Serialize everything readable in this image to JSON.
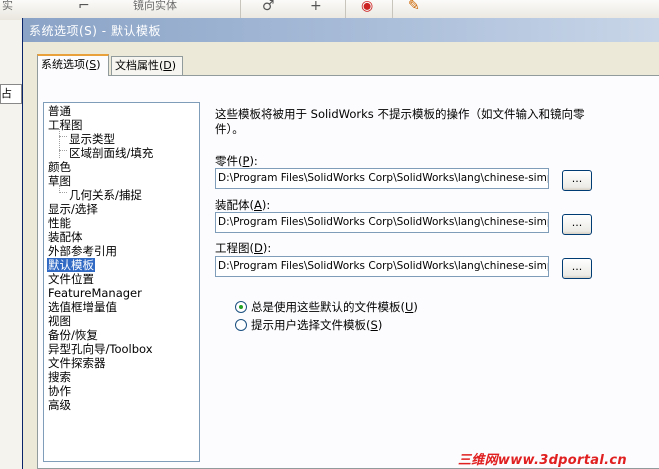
{
  "background_app": {
    "toolbar_label": "镜向实体",
    "left_strip_fragment_1": "实",
    "left_strip_fragment_2": "占",
    "icons": [
      "curve-icon",
      "plus-icon",
      "target-icon",
      "sketch-icon"
    ]
  },
  "dialog": {
    "title": "系统选项(S) - 默认模板",
    "tabs": [
      {
        "label": "系统选项",
        "mnemonic": "S",
        "active": true
      },
      {
        "label": "文档属性",
        "mnemonic": "D",
        "active": false
      }
    ],
    "tree": [
      {
        "label": "普通",
        "level": 0
      },
      {
        "label": "工程图",
        "level": 0
      },
      {
        "label": "显示类型",
        "level": 1
      },
      {
        "label": "区域剖面线/填充",
        "level": 1
      },
      {
        "label": "颜色",
        "level": 0
      },
      {
        "label": "草图",
        "level": 0
      },
      {
        "label": "几何关系/捕捉",
        "level": 1
      },
      {
        "label": "显示/选择",
        "level": 0
      },
      {
        "label": "性能",
        "level": 0
      },
      {
        "label": "装配体",
        "level": 0
      },
      {
        "label": "外部参考引用",
        "level": 0
      },
      {
        "label": "默认模板",
        "level": 0,
        "selected": true
      },
      {
        "label": "文件位置",
        "level": 0
      },
      {
        "label": "FeatureManager",
        "level": 0
      },
      {
        "label": "选值框增量值",
        "level": 0
      },
      {
        "label": "视图",
        "level": 0
      },
      {
        "label": "备份/恢复",
        "level": 0
      },
      {
        "label": "异型孔向导/Toolbox",
        "level": 0
      },
      {
        "label": "文件探索器",
        "level": 0
      },
      {
        "label": "搜索",
        "level": 0
      },
      {
        "label": "协作",
        "level": 0
      },
      {
        "label": "高级",
        "level": 0
      }
    ],
    "description": "这些模板将被用于 SolidWorks 不提示模板的操作（如文件输入和镜向零件）。",
    "fields": [
      {
        "label": "零件",
        "mnemonic": "P",
        "value": "D:\\Program Files\\SolidWorks Corp\\SolidWorks\\lang\\chinese-simplified\\Tutorial\\part.prtdot",
        "button": "..."
      },
      {
        "label": "装配体",
        "mnemonic": "A",
        "value": "D:\\Program Files\\SolidWorks Corp\\SolidWorks\\lang\\chinese-simplified\\Tutorial\\assem.asmdot",
        "button": "..."
      },
      {
        "label": "工程图",
        "mnemonic": "D",
        "value": "D:\\Program Files\\SolidWorks Corp\\SolidWorks\\lang\\chinese-simplified\\Tutorial\\draw.drwdot",
        "button": "..."
      }
    ],
    "radios": [
      {
        "label": "总是使用这些默认的文件模板",
        "mnemonic": "U",
        "checked": true
      },
      {
        "label": "提示用户选择文件模板",
        "mnemonic": "S",
        "checked": false
      }
    ]
  },
  "watermark": "三维网www.3dportal.cn"
}
